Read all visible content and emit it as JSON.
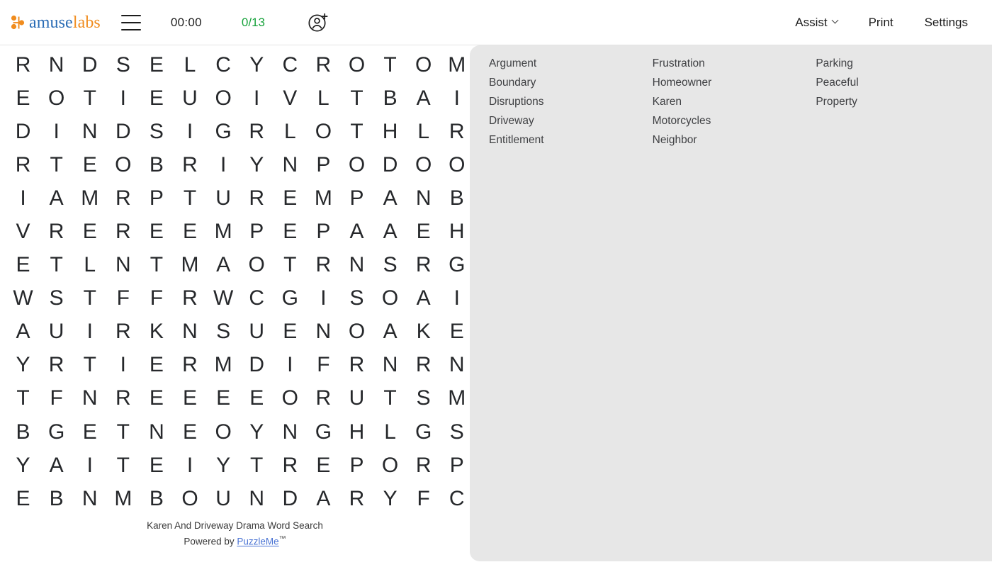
{
  "header": {
    "logo": {
      "name": "amuselabs",
      "part1": "amuse",
      "part2": "labs"
    },
    "menu_icon": "hamburger-icon",
    "timer": "00:00",
    "progress": "0/13",
    "add_user_icon": "add-user-icon",
    "assist_label": "Assist",
    "print_label": "Print",
    "settings_label": "Settings",
    "colors": {
      "logo_blue": "#2a6cb5",
      "logo_orange": "#f08c1e",
      "progress_green": "#17a23b",
      "panel_bg": "#e7e7e7",
      "link_blue": "#4b74d4"
    }
  },
  "puzzle": {
    "title": "Karen And Driveway Drama Word Search",
    "powered_by_prefix": "Powered by ",
    "powered_by_link": "PuzzleMe",
    "trademark": "™",
    "rows": 14,
    "cols": 14,
    "grid": [
      [
        "R",
        "N",
        "D",
        "S",
        "E",
        "L",
        "C",
        "Y",
        "C",
        "R",
        "O",
        "T",
        "O",
        "M"
      ],
      [
        "E",
        "O",
        "T",
        "I",
        "E",
        "U",
        "O",
        "I",
        "V",
        "L",
        "T",
        "B",
        "A",
        "I"
      ],
      [
        "D",
        "I",
        "N",
        "D",
        "S",
        "I",
        "G",
        "R",
        "L",
        "O",
        "T",
        "H",
        "L",
        "R"
      ],
      [
        "R",
        "T",
        "E",
        "O",
        "B",
        "R",
        "I",
        "Y",
        "N",
        "P",
        "O",
        "D",
        "O",
        "O"
      ],
      [
        "I",
        "A",
        "M",
        "R",
        "P",
        "T",
        "U",
        "R",
        "E",
        "M",
        "P",
        "A",
        "N",
        "B"
      ],
      [
        "V",
        "R",
        "E",
        "R",
        "E",
        "E",
        "M",
        "P",
        "E",
        "P",
        "A",
        "A",
        "E",
        "H"
      ],
      [
        "E",
        "T",
        "L",
        "N",
        "T",
        "M",
        "A",
        "O",
        "T",
        "R",
        "N",
        "S",
        "R",
        "G"
      ],
      [
        "W",
        "S",
        "T",
        "F",
        "F",
        "R",
        "W",
        "C",
        "G",
        "I",
        "S",
        "O",
        "A",
        "I"
      ],
      [
        "A",
        "U",
        "I",
        "R",
        "K",
        "N",
        "S",
        "U",
        "E",
        "N",
        "O",
        "A",
        "K",
        "E"
      ],
      [
        "Y",
        "R",
        "T",
        "I",
        "E",
        "R",
        "M",
        "D",
        "I",
        "F",
        "R",
        "N",
        "R",
        "N"
      ],
      [
        "T",
        "F",
        "N",
        "R",
        "E",
        "E",
        "E",
        "E",
        "O",
        "R",
        "U",
        "T",
        "S",
        "M"
      ],
      [
        "B",
        "G",
        "E",
        "T",
        "N",
        "E",
        "O",
        "Y",
        "N",
        "G",
        "H",
        "L",
        "G",
        "S"
      ],
      [
        "Y",
        "A",
        "I",
        "T",
        "E",
        "I",
        "Y",
        "T",
        "R",
        "E",
        "P",
        "O",
        "R",
        "P"
      ],
      [
        "E",
        "B",
        "N",
        "M",
        "B",
        "O",
        "U",
        "N",
        "D",
        "A",
        "R",
        "Y",
        "F",
        "C"
      ]
    ]
  },
  "wordlist": {
    "columns": [
      [
        "Argument",
        "Boundary",
        "Disruptions",
        "Driveway",
        "Entitlement"
      ],
      [
        "Frustration",
        "Homeowner",
        "Karen",
        "Motorcycles",
        "Neighbor"
      ],
      [
        "Parking",
        "Peaceful",
        "Property"
      ]
    ]
  }
}
